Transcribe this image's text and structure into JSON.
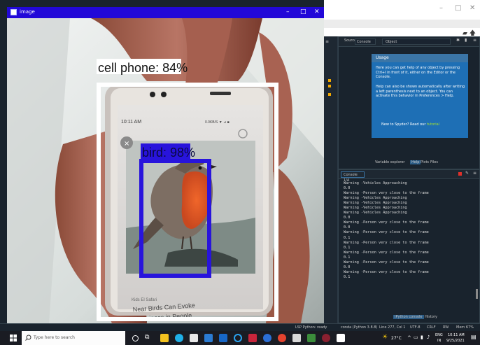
{
  "spyder": {
    "window_controls": [
      "–",
      "□",
      "✕"
    ],
    "help": {
      "source_label": "Source",
      "source_value": "Console",
      "object_label": "Object",
      "card_title": "Usage",
      "para1": "Here you can get help of any object by pressing Ctrl+I in front of it, either on the Editor or the Console.",
      "para2": "Help can also be shown automatically after writing a left parenthesis next to an object. You can activate this behavior in Preferences > Help.",
      "new_to_spyder": "New to Spyder? Read our",
      "tutorial_link": "tutorial",
      "tabs": [
        "Variable explorer",
        "Help",
        "Plots",
        "Files"
      ]
    },
    "console": {
      "tab_label": "Console 1/A",
      "lines": [
        "Warning -Vehicles Approaching",
        "0.0",
        "Warning -Person very close to the frame",
        "Warning -Vehicles Approaching",
        "Warning -Vehicles Approaching",
        "Warning -Vehicles Approaching",
        "Warning -Vehicles Approaching",
        "0.0",
        "Warning -Person very close to the frame",
        "0.0",
        "Warning -Person very close to the frame",
        "0.1",
        "Warning -Person very close to the frame",
        "0.1",
        "Warning -Person very close to the frame",
        "0.1",
        "Warning -Person very close to the frame",
        "0.0",
        "Warning -Person very close to the frame",
        "0.1"
      ],
      "bottom_tabs": [
        "IPython console",
        "History"
      ]
    },
    "status": {
      "lsp": "LSP Python: ready",
      "conda": "conda (Python 3.8.8)",
      "position": "Line 277, Col 1",
      "encoding": "UTF-8",
      "eol": "CRLF",
      "mode": "RW",
      "memory": "Mem 67%"
    }
  },
  "cv_window": {
    "title": "image",
    "controls": [
      "–",
      "□",
      "✕"
    ],
    "detections": [
      {
        "label": "cell phone: 84%",
        "box_color": "#ffffff"
      },
      {
        "label": "bird: 98%",
        "box_color": "#2814dc"
      }
    ],
    "phone_screen": {
      "time": "10:11 AM",
      "status": "0.0KB/S ▼ ⊿ ■",
      "caption1": "Near Birds Can Evoke",
      "caption2": "Happiness in People",
      "caption3": "Kids El Safari"
    }
  },
  "taskbar": {
    "search_placeholder": "Type here to search",
    "temperature": "27°C",
    "language": "ENG",
    "region": "IN",
    "time": "10:11 AM",
    "date": "9/25/2021"
  },
  "colors": {
    "cv_title_bar": "#2208d8",
    "spyder_bg": "#19232d",
    "help_card": "#1e6fb5"
  }
}
